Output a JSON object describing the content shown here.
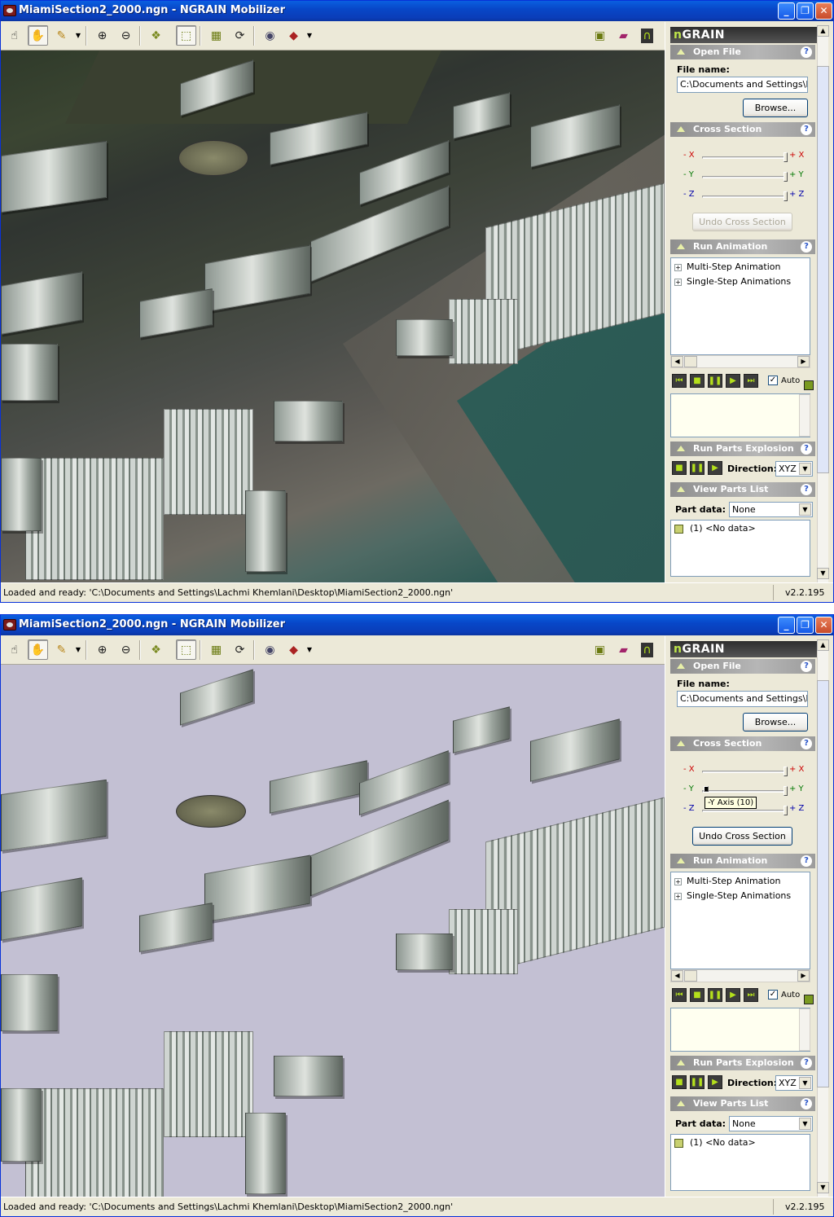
{
  "windows": [
    {
      "title": "MiamiSection2_2000.ngn - NGRAIN Mobilizer",
      "state": "with-terrain",
      "logo": "nGRAIN",
      "open_file": {
        "header": "Open File",
        "file_label": "File name:",
        "file_value": "C:\\Documents and Settings\\L",
        "browse": "Browse..."
      },
      "cross_section": {
        "header": "Cross Section",
        "x_minus": "- X",
        "x_plus": "+ X",
        "y_minus": "- Y",
        "y_plus": "+ Y",
        "z_minus": "- Z",
        "z_plus": "+ Z",
        "undo": "Undo Cross Section",
        "undo_enabled": false,
        "tooltip": ""
      },
      "run_animation": {
        "header": "Run Animation",
        "items": [
          "Multi-Step Animation",
          "Single-Step Animations"
        ],
        "auto": "Auto",
        "auto_checked": true
      },
      "parts_explosion": {
        "header": "Run Parts Explosion",
        "direction_label": "Direction:",
        "direction_value": "XYZ"
      },
      "parts_list": {
        "header": "View Parts List",
        "part_data_label": "Part data:",
        "part_data_value": "None",
        "item": "(1) <No data>"
      },
      "status": "Loaded and ready: 'C:\\Documents and Settings\\Lachmi Khemlani\\Desktop\\MiamiSection2_2000.ngn'",
      "version": "v2.2.195"
    },
    {
      "title": "MiamiSection2_2000.ngn - NGRAIN Mobilizer",
      "state": "cross-section",
      "logo": "nGRAIN",
      "open_file": {
        "header": "Open File",
        "file_label": "File name:",
        "file_value": "C:\\Documents and Settings\\L",
        "browse": "Browse..."
      },
      "cross_section": {
        "header": "Cross Section",
        "x_minus": "- X",
        "x_plus": "+ X",
        "y_minus": "- Y",
        "y_plus": "+ Y",
        "z_minus": "- Z",
        "z_plus": "+ Z",
        "undo": "Undo Cross Section",
        "undo_enabled": true,
        "tooltip": "-Y Axis (10)"
      },
      "run_animation": {
        "header": "Run Animation",
        "items": [
          "Multi-Step Animation",
          "Single-Step Animations"
        ],
        "auto": "Auto",
        "auto_checked": true
      },
      "parts_explosion": {
        "header": "Run Parts Explosion",
        "direction_label": "Direction:",
        "direction_value": "XYZ"
      },
      "parts_list": {
        "header": "View Parts List",
        "part_data_label": "Part data:",
        "part_data_value": "None",
        "item": "(1) <No data>"
      },
      "status": "Loaded and ready: 'C:\\Documents and Settings\\Lachmi Khemlani\\Desktop\\MiamiSection2_2000.ngn'",
      "version": "v2.2.195"
    }
  ],
  "toolbar_icons": [
    "select-pointer-icon",
    "pan-hand-icon",
    "markup-pen-icon",
    "zoom-in-icon",
    "zoom-out-icon",
    "parts-select-icon",
    "cursor-box-icon",
    "explode-parts-icon",
    "rotate-reset-icon",
    "render-mode-icon",
    "box-view-icon",
    "library-icon",
    "manual-book-icon",
    "ngrain-logo-icon"
  ],
  "colors": {
    "titlebar": "#0a3db8",
    "accent_green": "#b4e01c",
    "viewport_section_bg": "#c3c0d3"
  }
}
